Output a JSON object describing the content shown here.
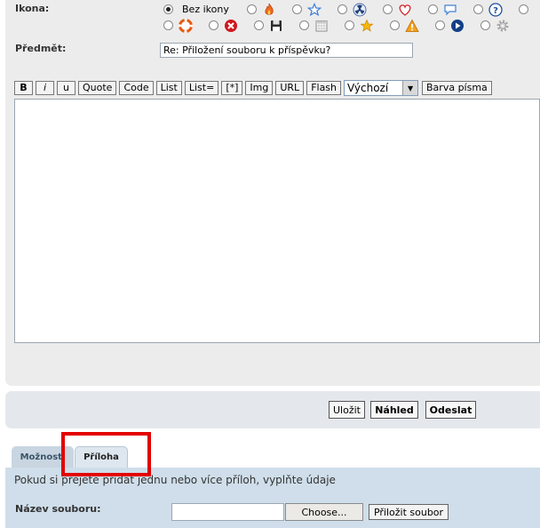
{
  "icon_field": {
    "label": "Ikona:",
    "no_icon_label": "Bez ikony",
    "row1_icons": [
      "fire-icon",
      "star-outline-icon",
      "radiation-icon",
      "heart-icon",
      "speech-bubble-icon",
      "question-icon"
    ],
    "row2_icons": [
      "lifebuoy-icon",
      "stop-icon",
      "floppy-disk-icon",
      "calendar-icon",
      "star-icon",
      "warning-icon",
      "play-icon",
      "gear-icon"
    ]
  },
  "subject": {
    "label": "Předmět:",
    "value": "Re: Přiložení souboru k příspěvku?"
  },
  "toolbar": {
    "bold": "B",
    "italic": "i",
    "underline": "u",
    "quote": "Quote",
    "code": "Code",
    "list": "List",
    "list_ordered": "List=",
    "list_item": "[*]",
    "img": "Img",
    "url": "URL",
    "flash": "Flash",
    "font_size_selected": "Výchozí",
    "font_color": "Barva písma"
  },
  "actions": {
    "save": "Uložit",
    "preview": "Náhled",
    "submit": "Odeslat"
  },
  "tabs": {
    "options": "Možnosti",
    "attachment": "Příloha"
  },
  "attachment": {
    "instructions": "Pokud si přejete přidat jednu nebo více příloh, vyplňte údaje",
    "filename_label": "Název souboru:",
    "choose_button": "Choose...",
    "attach_button": "Přiložit soubor"
  },
  "colors": {
    "highlight": "#e30000",
    "panel_bg": "#ececec",
    "attachment_panel_bg": "#cfdeea"
  }
}
